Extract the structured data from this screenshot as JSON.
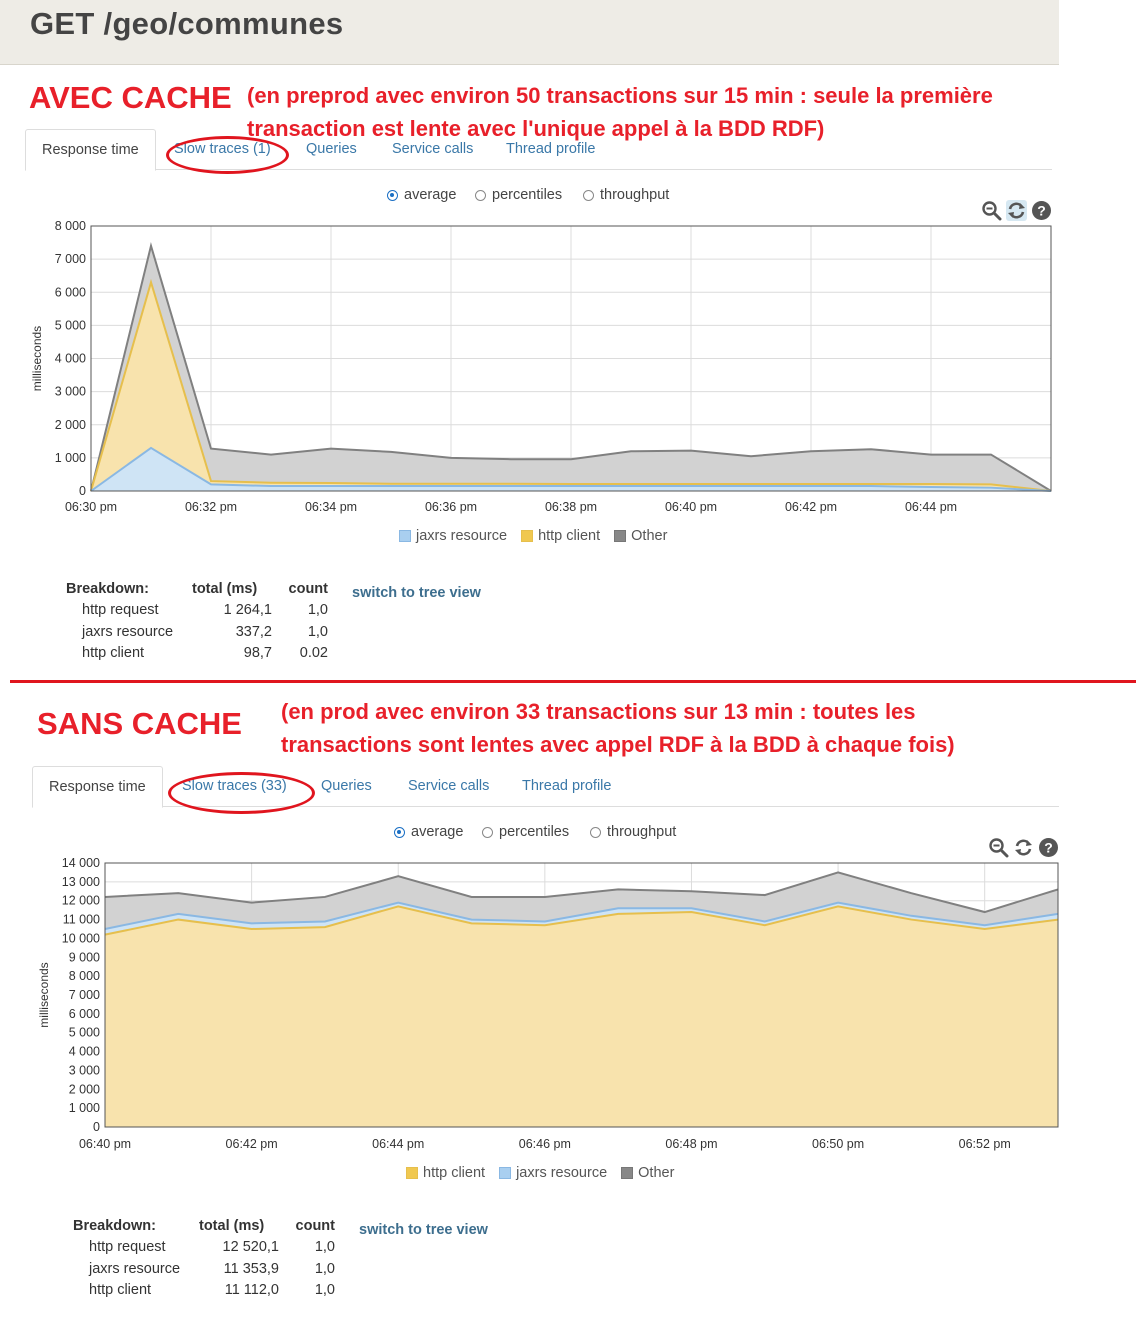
{
  "header": {
    "title": "GET /geo/communes"
  },
  "section1": {
    "label": "AVEC CACHE",
    "note_line1": "(en preprod avec environ 50 transactions sur 15 min : seule la première",
    "note_line2": "transaction est lente avec l'unique appel à la BDD RDF)",
    "tabs": [
      "Response time",
      "Slow traces (1)",
      "Queries",
      "Service calls",
      "Thread profile"
    ],
    "radios": [
      "average",
      "percentiles",
      "throughput"
    ],
    "selected_radio": "average",
    "tools": [
      "zoom-out-icon",
      "refresh-icon",
      "help-icon"
    ],
    "legend": [
      "jaxrs resource",
      "http client",
      "Other"
    ],
    "breakdown": {
      "header": [
        "Breakdown:",
        "total (ms)",
        "count"
      ],
      "rows": [
        [
          "http request",
          "1 264,1",
          "1,0"
        ],
        [
          "jaxrs resource",
          "337,2",
          "1,0"
        ],
        [
          "http client",
          "98,7",
          "0.02"
        ]
      ]
    },
    "switch_label": "switch to tree view"
  },
  "section2": {
    "label": "SANS CACHE",
    "note_line1": "(en prod avec environ 33 transactions sur 13 min : toutes les",
    "note_line2": "transactions sont lentes avec appel RDF à la BDD à chaque fois)",
    "tabs": [
      "Response time",
      "Slow traces (33)",
      "Queries",
      "Service calls",
      "Thread profile"
    ],
    "radios": [
      "average",
      "percentiles",
      "throughput"
    ],
    "selected_radio": "average",
    "tools": [
      "zoom-out-icon",
      "refresh-icon",
      "help-icon"
    ],
    "legend": [
      "http client",
      "jaxrs resource",
      "Other"
    ],
    "breakdown": {
      "header": [
        "Breakdown:",
        "total (ms)",
        "count"
      ],
      "rows": [
        [
          "http request",
          "12 520,1",
          "1,0"
        ],
        [
          "jaxrs resource",
          "11 353,9",
          "1,0"
        ],
        [
          "http client",
          "11 112,0",
          "1,0"
        ]
      ]
    },
    "switch_label": "switch to tree view"
  },
  "colors": {
    "jaxrs": "#cfe4f5",
    "jaxrs_line": "#8ab8e3",
    "http": "#f8e3ad",
    "http_line": "#e6bf4d",
    "other": "#d2d2d2",
    "other_line": "#808080",
    "accent_red": "#e0151e"
  },
  "chart_data": [
    {
      "type": "area",
      "stacked": true,
      "ylabel": "milliseconds",
      "ylim": [
        0,
        8000
      ],
      "yticks": [
        "0",
        "1 000",
        "2 000",
        "3 000",
        "4 000",
        "5 000",
        "6 000",
        "7 000",
        "8 000"
      ],
      "xlim": [
        0,
        16
      ],
      "xtick_labels": [
        "06:30 pm",
        "06:32 pm",
        "06:34 pm",
        "06:36 pm",
        "06:38 pm",
        "06:40 pm",
        "06:42 pm",
        "06:44 pm"
      ],
      "xtick_minutes": [
        0,
        2,
        4,
        6,
        8,
        10,
        12,
        14
      ],
      "x_minutes": [
        0,
        1,
        2,
        3,
        4,
        5,
        6,
        7,
        8,
        9,
        10,
        11,
        12,
        13,
        14,
        15,
        16
      ],
      "series": [
        {
          "name": "jaxrs resource",
          "key": "jaxrs",
          "cumulative": [
            0,
            1300,
            200,
            150,
            150,
            150,
            150,
            150,
            150,
            150,
            150,
            150,
            150,
            150,
            120,
            100,
            0
          ]
        },
        {
          "name": "http client",
          "key": "http",
          "cumulative": [
            0,
            6300,
            300,
            250,
            240,
            220,
            220,
            220,
            210,
            210,
            210,
            210,
            210,
            210,
            210,
            200,
            0
          ]
        },
        {
          "name": "Other",
          "key": "other",
          "cumulative": [
            0,
            7400,
            1280,
            1100,
            1280,
            1180,
            1000,
            960,
            960,
            1200,
            1220,
            1050,
            1200,
            1260,
            1100,
            1100,
            0
          ]
        }
      ]
    },
    {
      "type": "area",
      "stacked": true,
      "ylabel": "milliseconds",
      "ylim": [
        0,
        14000
      ],
      "yticks": [
        "0",
        "1 000",
        "2 000",
        "3 000",
        "4 000",
        "5 000",
        "6 000",
        "7 000",
        "8 000",
        "9 000",
        "10 000",
        "11 000",
        "12 000",
        "13 000",
        "14 000"
      ],
      "xlim": [
        0,
        13
      ],
      "xtick_labels": [
        "06:40 pm",
        "06:42 pm",
        "06:44 pm",
        "06:46 pm",
        "06:48 pm",
        "06:50 pm",
        "06:52 pm"
      ],
      "xtick_minutes": [
        0,
        2,
        4,
        6,
        8,
        10,
        12
      ],
      "x_minutes": [
        0,
        1,
        2,
        3,
        4,
        5,
        6,
        7,
        8,
        9,
        10,
        11,
        12,
        13
      ],
      "series": [
        {
          "name": "http client",
          "key": "http",
          "cumulative": [
            10200,
            11000,
            10500,
            10600,
            11700,
            10800,
            10700,
            11300,
            11400,
            10700,
            11700,
            11000,
            10500,
            11000
          ]
        },
        {
          "name": "jaxrs resource",
          "key": "jaxrs",
          "cumulative": [
            10500,
            11300,
            10800,
            10900,
            11900,
            11000,
            10900,
            11600,
            11600,
            10900,
            11900,
            11200,
            10700,
            11300
          ]
        },
        {
          "name": "Other",
          "key": "other",
          "cumulative": [
            12200,
            12400,
            11900,
            12200,
            13300,
            12200,
            12200,
            12600,
            12500,
            12300,
            13500,
            12400,
            11400,
            12600
          ]
        }
      ]
    }
  ]
}
